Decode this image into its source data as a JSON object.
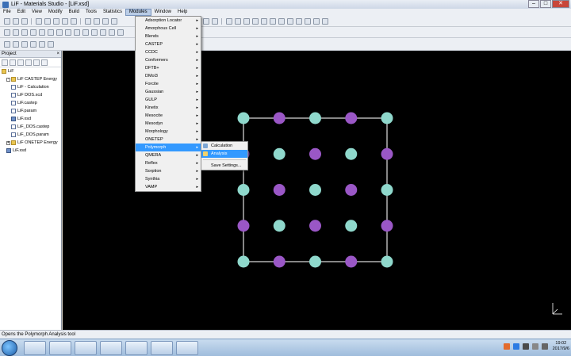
{
  "window": {
    "title": "LiF - Materials Studio - [LiF.xsd]",
    "minimize": "–",
    "maximize": "□",
    "close": "✕"
  },
  "menubar": [
    "File",
    "Edit",
    "View",
    "Modify",
    "Build",
    "Tools",
    "Statistics",
    "Modules",
    "Window",
    "Help"
  ],
  "modules_menu": [
    "Adsorption Locator",
    "Amorphous Cell",
    "Blends",
    "CASTEP",
    "CCDC",
    "Conformers",
    "DFTB+",
    "DMol3",
    "Forcite",
    "Gaussian",
    "GULP",
    "Kinetix",
    "Mesocite",
    "Mesodyn",
    "Morphology",
    "ONETEP",
    "Polymorph",
    "QMERA",
    "Reflex",
    "Sorption",
    "Synthia",
    "VAMP"
  ],
  "polymorph_submenu": [
    "Calculation",
    "Analysis",
    "Save Settings..."
  ],
  "project": {
    "title": "Project",
    "close": "×",
    "tree": [
      {
        "label": "LiF",
        "icon": "folder",
        "indent": 0,
        "exp": ""
      },
      {
        "label": "LiF CASTEP Energy",
        "icon": "folder",
        "indent": 1,
        "exp": "-"
      },
      {
        "label": "LiF - Calculation",
        "icon": "doc",
        "indent": 2,
        "exp": ""
      },
      {
        "label": "LiF DOS.xcd",
        "icon": "doc",
        "indent": 2,
        "exp": ""
      },
      {
        "label": "LiF.castep",
        "icon": "doc",
        "indent": 2,
        "exp": ""
      },
      {
        "label": "LiF.param",
        "icon": "doc",
        "indent": 2,
        "exp": ""
      },
      {
        "label": "LiF.xsd",
        "icon": "xsd",
        "indent": 2,
        "exp": ""
      },
      {
        "label": "LiF_DOS.castep",
        "icon": "doc",
        "indent": 2,
        "exp": ""
      },
      {
        "label": "LiF_DOS.param",
        "icon": "doc",
        "indent": 2,
        "exp": ""
      },
      {
        "label": "LiF ONETEP Energy",
        "icon": "folder",
        "indent": 1,
        "exp": "+"
      },
      {
        "label": "LiF.xsd",
        "icon": "xsd",
        "indent": 1,
        "exp": ""
      }
    ]
  },
  "status": "Opens the Polymorph Analysis tool",
  "clock": {
    "time": "19:02",
    "date": "2017/9/6"
  },
  "colors": {
    "li_atom": "#9a57c6",
    "f_atom": "#8fd8cc",
    "highlight": "#3399ff",
    "viewport": "#000000"
  },
  "icons": [
    "windows-start-icon",
    "ie-icon",
    "folder-icon",
    "media-player-icon",
    "ms-icon",
    "app-icon",
    "bird-icon",
    "materials-studio-icon"
  ]
}
